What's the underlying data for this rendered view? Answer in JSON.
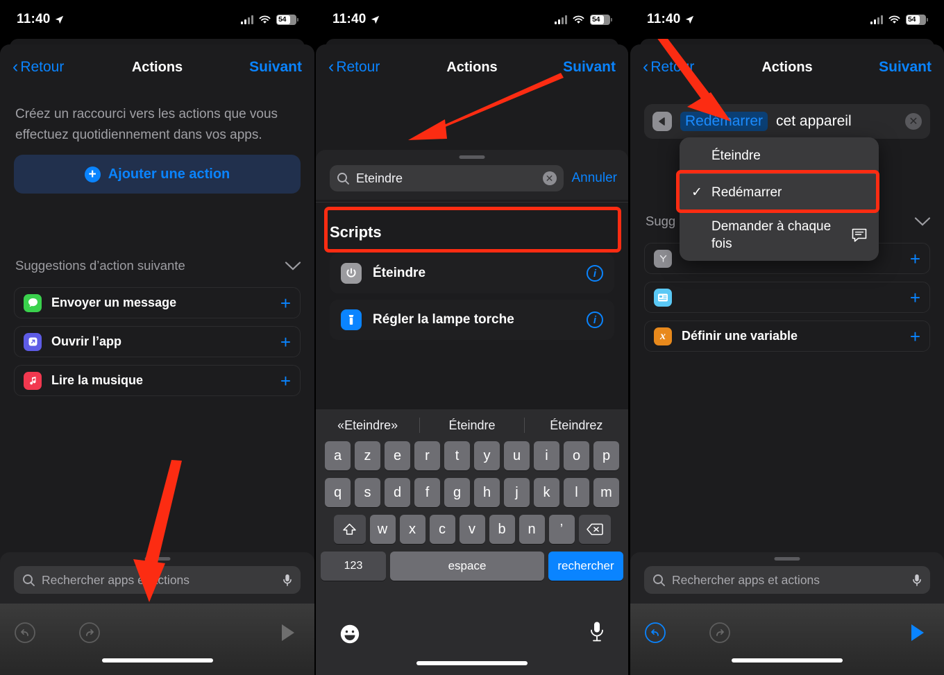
{
  "status_bar": {
    "time": "11:40",
    "battery_percent": "54",
    "location_icon": "location-arrow-icon",
    "cellular_icon": "cellular-bars-icon",
    "wifi_icon": "wifi-icon"
  },
  "nav": {
    "back_label": "Retour",
    "title": "Actions",
    "next_label": "Suivant"
  },
  "panel1": {
    "intro_text": "Créez un raccourci vers les actions que vous effectuez quotidiennement dans vos apps.",
    "add_action_label": "Ajouter une action",
    "suggestions_header": "Suggestions d’action suivante",
    "suggestions": [
      {
        "label": "Envoyer un message",
        "icon": "messages-app-icon",
        "add": "+"
      },
      {
        "label": "Ouvrir l’app",
        "icon": "open-app-icon",
        "add": "+"
      },
      {
        "label": "Lire la musique",
        "icon": "music-app-icon",
        "add": "+"
      }
    ],
    "search_placeholder": "Rechercher apps et actions",
    "search_icon": "search-icon",
    "mic_icon": "microphone-icon",
    "toolbar": {
      "undo_icon": "undo-icon",
      "redo_icon": "redo-icon",
      "play_icon": "play-icon"
    }
  },
  "panel2": {
    "search_value": "Eteindre",
    "search_icon": "search-icon",
    "clear_icon": "clear-circle-icon",
    "cancel_label": "Annuler",
    "section_title": "Scripts",
    "results": [
      {
        "label": "Éteindre",
        "icon": "power-icon",
        "info": "info-icon"
      },
      {
        "label": "Régler la lampe torche",
        "icon": "flashlight-icon",
        "info": "info-icon"
      }
    ],
    "keyboard": {
      "predictions": [
        "«Eteindre»",
        "Éteindre",
        "Éteindrez"
      ],
      "row1": [
        "a",
        "z",
        "e",
        "r",
        "t",
        "y",
        "u",
        "i",
        "o",
        "p"
      ],
      "row2": [
        "q",
        "s",
        "d",
        "f",
        "g",
        "h",
        "j",
        "k",
        "l",
        "m"
      ],
      "row3": [
        "w",
        "x",
        "c",
        "v",
        "b",
        "n",
        "’"
      ],
      "shift_icon": "shift-icon",
      "backspace_icon": "backspace-icon",
      "numbers_label": "123",
      "space_label": "espace",
      "return_label": "rechercher",
      "emoji_icon": "emoji-icon",
      "dictation_icon": "microphone-icon"
    }
  },
  "panel3": {
    "action": {
      "run_icon": "play-triangle-icon",
      "token_label": "Redémarrer",
      "tail_text": "cet appareil",
      "remove_icon": "clear-circle-icon"
    },
    "dropdown": {
      "items": [
        {
          "label": "Éteindre",
          "checked": false
        },
        {
          "label": "Redémarrer",
          "checked": true
        },
        {
          "label": "Demander à chaque fois",
          "checked": false,
          "trailing_icon": "ask-bubble-icon"
        }
      ],
      "check_glyph": "✓"
    },
    "suggestions_header": "Sugg",
    "suggestions": [
      {
        "label": "",
        "icon": "shortcut-y-icon",
        "add": "+"
      },
      {
        "label": "",
        "icon": "card-icon",
        "add": "+"
      },
      {
        "label": "Définir une variable",
        "icon": "variable-x-icon",
        "add": "+"
      }
    ],
    "search_placeholder": "Rechercher apps et actions",
    "search_icon": "search-icon",
    "mic_icon": "microphone-icon",
    "toolbar": {
      "undo_icon": "undo-icon",
      "redo_icon": "redo-icon",
      "play_icon": "play-icon"
    }
  },
  "annotations": {
    "highlight_color": "#fc2c12",
    "arrows": [
      {
        "name": "arrow-to-search-field"
      },
      {
        "name": "arrow-to-search-term"
      },
      {
        "name": "arrow-to-redemarrer-token"
      }
    ],
    "highlights": [
      {
        "name": "highlight-eteindre-result"
      },
      {
        "name": "highlight-redemarrer-option"
      }
    ]
  }
}
